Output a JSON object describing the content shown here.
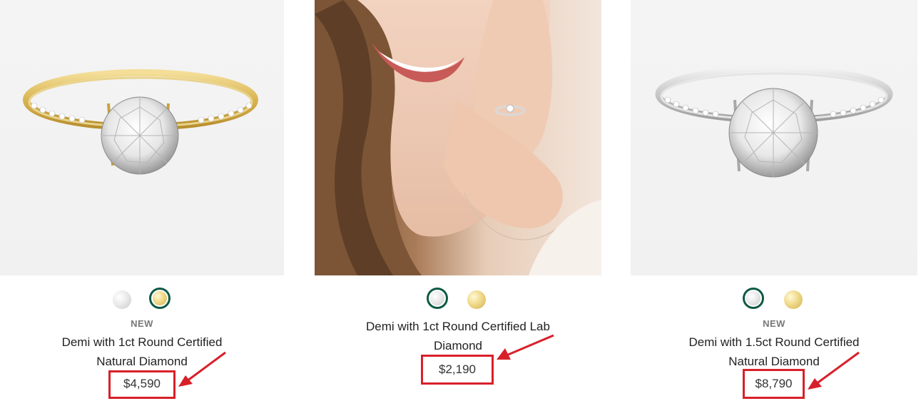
{
  "products": [
    {
      "image": "gold-solitaire-ring-image",
      "swatches": [
        {
          "metal": "white-gold",
          "color": "#d9d9d9",
          "selected": false
        },
        {
          "metal": "yellow-gold",
          "color": "#e8cf7a",
          "selected": true
        }
      ],
      "badge": "NEW",
      "title_line1": "Demi with 1ct Round Certified",
      "title_line2": "Natural Diamond",
      "price": "$4,590"
    },
    {
      "image": "model-wearing-ring-image",
      "swatches": [
        {
          "metal": "white-gold",
          "color": "#d9d9d9",
          "selected": true
        },
        {
          "metal": "yellow-gold",
          "color": "#e8cf7a",
          "selected": false
        }
      ],
      "badge": "",
      "title_line1": "Demi with 1ct Round Certified Lab",
      "title_line2": "Diamond",
      "price": "$2,190"
    },
    {
      "image": "white-gold-solitaire-ring-image",
      "swatches": [
        {
          "metal": "white-gold",
          "color": "#d9d9d9",
          "selected": true
        },
        {
          "metal": "yellow-gold",
          "color": "#e8cf7a",
          "selected": false
        }
      ],
      "badge": "NEW",
      "title_line1": "Demi with 1.5ct Round Certified",
      "title_line2": "Natural Diamond",
      "price": "$8,790"
    }
  ],
  "annotation_color": "#d8202a",
  "selected_ring_color": "#0d5a45"
}
